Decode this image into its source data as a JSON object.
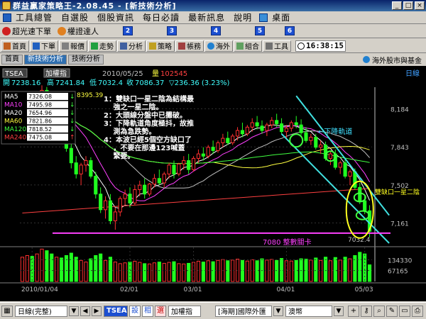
{
  "window": {
    "title": "群益贏家策略王-2.08.45 - [新技術分析]"
  },
  "menu": {
    "items": [
      "工具總管",
      "自選股",
      "個股資訊",
      "每日必讀",
      "最新訊息",
      "說明",
      "桌面"
    ]
  },
  "quickbar": {
    "items": [
      "超光速下單",
      "權證達人"
    ],
    "numbers": [
      "2",
      "3",
      "4",
      "5",
      "6"
    ]
  },
  "toolbar": {
    "buttons": [
      "首頁",
      "下單",
      "報價",
      "走勢",
      "分析",
      "策略",
      "帳務",
      "海外",
      "組合",
      "工具"
    ],
    "clock": "16:38:15"
  },
  "tabs": {
    "items": [
      "首頁",
      "新技術分析",
      "技術分析"
    ],
    "right_link": "海外股市與基金"
  },
  "chart_header": {
    "symbol": "TSEA",
    "mode": "加權指",
    "date": "2010/05/25",
    "volume_label": "量",
    "volume_value": "102545",
    "open_label": "開",
    "open_value": "7238.16",
    "high_label": "高",
    "high_value": "7241.84",
    "low_label": "低",
    "low_value": "7032.4",
    "close_label": "收",
    "close_value": "7086.37",
    "change": "▽236.36 (3.23%)",
    "period": "日線"
  },
  "chart_data": {
    "type": "candlestick",
    "x_tick_labels": [
      "2010/01/04",
      "02/01",
      "03/01",
      "04/01",
      "05/03"
    ],
    "y_tick_labels": [
      "8,184",
      "7,843",
      "7,502",
      "7,161"
    ],
    "y_range": [
      6980,
      8340
    ],
    "volume_tick_labels": [
      "134330",
      "67165"
    ],
    "volume_range": [
      0,
      201500
    ],
    "annotations": {
      "peak_value": "8395.39",
      "low_marker": "7032.4",
      "support_label": "7080 整數關卡",
      "trend_label": "←下降軌道",
      "gap_label": "雙缺口一星二陰"
    },
    "legend": [
      {
        "name": "MA5",
        "value": "7326.08",
        "arrow": "↓",
        "color": "#ffffff"
      },
      {
        "name": "MA10",
        "value": "7495.98",
        "arrow": "↓",
        "color": "#ff40ff"
      },
      {
        "name": "MA20",
        "value": "7654.96",
        "arrow": "↓",
        "color": "#ffffff"
      },
      {
        "name": "MA60",
        "value": "7821.86",
        "arrow": "↓",
        "color": "#ffff40"
      },
      {
        "name": "MA120",
        "value": "7818.52",
        "arrow": "↓",
        "color": "#40ff40"
      },
      {
        "name": "MA240",
        "value": "7475.08",
        "arrow": "↑",
        "color": "#ff4040"
      }
    ],
    "notes": [
      "1：雙缺口一星二陰為結構最",
      "　  強之一星二陰。",
      "2：大頭線分盤中已攤破。",
      "3：下降軌道角度極抖，故推",
      "　  測為急跌勢。",
      "4：本波已經5個空方缺口了",
      "　  ，不要在那邊123喊蓋",
      "　  緊要。"
    ],
    "candles": [
      [
        8120,
        8210,
        8060,
        8180
      ],
      [
        8180,
        8260,
        8120,
        8240
      ],
      [
        8240,
        8300,
        8170,
        8200
      ],
      [
        8200,
        8280,
        8150,
        8260
      ],
      [
        8260,
        8395,
        8230,
        8350
      ],
      [
        8350,
        8380,
        8180,
        8220
      ],
      [
        8220,
        8250,
        8050,
        8080
      ],
      [
        8080,
        8150,
        7980,
        8120
      ],
      [
        8120,
        8180,
        7950,
        7980
      ],
      [
        7980,
        8040,
        7800,
        7830
      ],
      [
        7830,
        7900,
        7650,
        7700
      ],
      [
        7700,
        7760,
        7560,
        7600
      ],
      [
        7600,
        7700,
        7500,
        7680
      ],
      [
        7680,
        7760,
        7620,
        7720
      ],
      [
        7720,
        7750,
        7560,
        7580
      ],
      [
        7580,
        7620,
        7380,
        7420
      ],
      [
        7420,
        7480,
        7250,
        7280
      ],
      [
        7280,
        7400,
        7200,
        7360
      ],
      [
        7360,
        7420,
        7150,
        7180
      ],
      [
        7180,
        7300,
        7100,
        7260
      ],
      [
        7260,
        7400,
        7220,
        7380
      ],
      [
        7380,
        7460,
        7320,
        7420
      ],
      [
        7420,
        7480,
        7300,
        7340
      ],
      [
        7340,
        7500,
        7320,
        7460
      ],
      [
        7460,
        7540,
        7400,
        7500
      ],
      [
        7500,
        7560,
        7380,
        7420
      ],
      [
        7420,
        7520,
        7400,
        7510
      ],
      [
        7510,
        7600,
        7480,
        7560
      ],
      [
        7560,
        7640,
        7500,
        7520
      ],
      [
        7520,
        7620,
        7480,
        7600
      ],
      [
        7600,
        7700,
        7560,
        7680
      ],
      [
        7680,
        7720,
        7560,
        7600
      ],
      [
        7600,
        7700,
        7580,
        7690
      ],
      [
        7690,
        7760,
        7640,
        7720
      ],
      [
        7720,
        7780,
        7600,
        7640
      ],
      [
        7640,
        7760,
        7620,
        7740
      ],
      [
        7740,
        7820,
        7700,
        7780
      ],
      [
        7780,
        7840,
        7720,
        7760
      ],
      [
        7760,
        7860,
        7740,
        7840
      ],
      [
        7840,
        7900,
        7780,
        7810
      ],
      [
        7810,
        7900,
        7790,
        7880
      ],
      [
        7880,
        7960,
        7840,
        7920
      ],
      [
        7920,
        7980,
        7860,
        7880
      ],
      [
        7880,
        7960,
        7860,
        7940
      ],
      [
        7940,
        8020,
        7900,
        7990
      ],
      [
        7990,
        8060,
        7930,
        7960
      ],
      [
        7960,
        8040,
        7940,
        8020
      ],
      [
        8020,
        8100,
        7980,
        8060
      ],
      [
        8060,
        8120,
        8000,
        8030
      ],
      [
        8030,
        8080,
        7960,
        7990
      ],
      [
        7990,
        8060,
        7940,
        8040
      ],
      [
        8040,
        8110,
        8010,
        8080
      ],
      [
        8080,
        8140,
        8020,
        8050
      ],
      [
        8050,
        8100,
        7960,
        7980
      ],
      [
        7980,
        8040,
        7920,
        8010
      ],
      [
        8010,
        8080,
        7980,
        8060
      ],
      [
        8060,
        8120,
        8010,
        8040
      ],
      [
        8040,
        8090,
        7950,
        7970
      ],
      [
        7970,
        8020,
        7880,
        7900
      ],
      [
        7900,
        7960,
        7860,
        7930
      ],
      [
        7930,
        7960,
        7820,
        7840
      ],
      [
        7840,
        7900,
        7780,
        7860
      ],
      [
        7860,
        7890,
        7720,
        7740
      ],
      [
        7740,
        7800,
        7680,
        7780
      ],
      [
        7780,
        7820,
        7640,
        7660
      ],
      [
        7660,
        7720,
        7600,
        7700
      ],
      [
        7700,
        7740,
        7560,
        7580
      ],
      [
        7580,
        7640,
        7500,
        7620
      ],
      [
        7620,
        7650,
        7460,
        7480
      ],
      [
        7480,
        7520,
        7330,
        7360
      ],
      [
        7360,
        7400,
        7240,
        7270
      ],
      [
        7270,
        7320,
        7032.4,
        7086.37
      ]
    ],
    "volumes": [
      150000,
      160000,
      155000,
      170000,
      200000,
      190000,
      170000,
      150000,
      145000,
      160000,
      175000,
      150000,
      130000,
      120000,
      140000,
      160000,
      170000,
      130000,
      150000,
      120000,
      110000,
      115000,
      120000,
      125000,
      118000,
      110000,
      108000,
      115000,
      120000,
      112000,
      118000,
      122000,
      110000,
      108000,
      112000,
      118000,
      125000,
      120000,
      128000,
      122000,
      130000,
      135000,
      128000,
      132000,
      138000,
      130000,
      126000,
      134000,
      128000,
      140000,
      132000,
      136000,
      130000,
      142000,
      128000,
      126000,
      130000,
      140000,
      138000,
      132000,
      145000,
      130000,
      150000,
      128000,
      148000,
      132000,
      150000,
      140000,
      160000,
      180000,
      170000,
      102545
    ],
    "channel": {
      "upper_start_index": 56,
      "upper_start_price": 8300,
      "upper_end_index": 75,
      "upper_end_price": 7230,
      "lower_start_index": 53,
      "lower_start_price": 7960,
      "lower_end_index": 75,
      "lower_end_price": 6980
    }
  }
}
